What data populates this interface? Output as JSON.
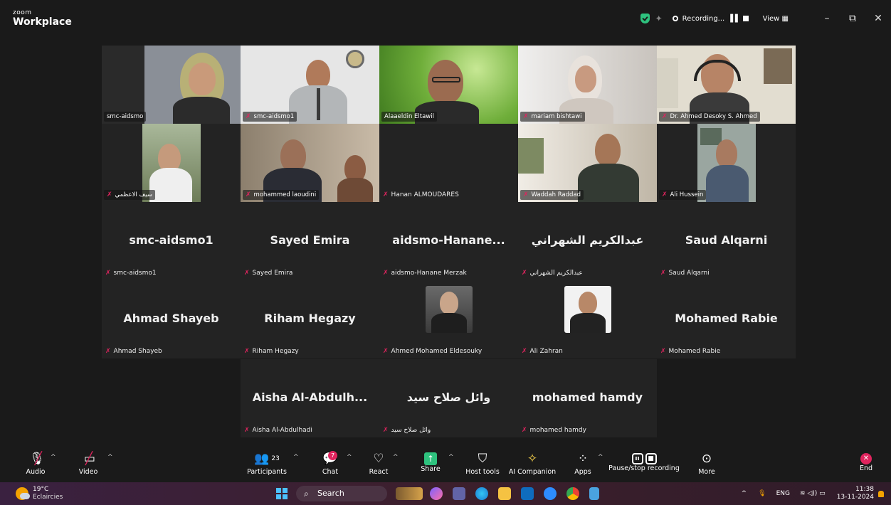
{
  "app": {
    "brand_top": "zoom",
    "brand_bottom": "Workplace"
  },
  "titlebar": {
    "recording_label": "Recording...",
    "view_label": "View",
    "view_icon": "grid-icon",
    "minimize": "–",
    "restore": "⧉",
    "close": "✕"
  },
  "video_tiles": [
    {
      "name": "smc-aidsmo",
      "muted": false,
      "bg": "#8a8f97",
      "shirt": "#2b2b2b",
      "skin": "#c99a7a",
      "hijab": "#b8b076"
    },
    {
      "name": "smc-aidsmo1",
      "muted": true,
      "bg": "#e6e6e6",
      "shirt": "#b3b6b8",
      "skin": "#b07a5a",
      "hijab": ""
    },
    {
      "name": "Alaaeldin Eltawil",
      "muted": false,
      "bg": "#6fae3a",
      "shirt": "#2a2a2a",
      "skin": "#9b6b50",
      "hijab": ""
    },
    {
      "name": "mariam bishtawi",
      "muted": true,
      "bg": "#d8d6d4",
      "shirt": "#cfc7bf",
      "skin": "#c89a80",
      "hijab": "#e8e2dc"
    },
    {
      "name": "Dr. Ahmed Desoky S. Ahmed",
      "muted": true,
      "bg": "#e2ddd0",
      "shirt": "#3a3a3a",
      "skin": "#b78466",
      "hijab": ""
    },
    {
      "name": "سيف الاعظمي",
      "muted": true,
      "bg": "#7b8a67",
      "shirt": "#efefef",
      "skin": "#c59a7c",
      "hijab": ""
    },
    {
      "name": "mohammed laoudini",
      "muted": true,
      "bg": "#a89a87",
      "shirt": "#2a2c34",
      "skin": "#9b7058",
      "hijab": "#8b5c43"
    },
    {
      "name": "Hanan ALMOUDARES",
      "muted": true,
      "bg": "#232323",
      "shirt": "",
      "skin": "",
      "hijab": ""
    },
    {
      "name": "Waddah Raddad",
      "muted": true,
      "bg": "#d9d2c4",
      "shirt": "#333a33",
      "skin": "#a57657",
      "hijab": ""
    },
    {
      "name": "Ali Hussein",
      "muted": true,
      "bg": "#9aa6a0",
      "shirt": "#4a5a70",
      "skin": "#a87a60",
      "hijab": ""
    }
  ],
  "name_tiles": [
    {
      "display": "smc-aidsmo1",
      "label": "smc-aidsmo1"
    },
    {
      "display": "Sayed Emira",
      "label": "Sayed Emira"
    },
    {
      "display": "aidsmo-Hanane...",
      "label": "aidsmo-Hanane Merzak"
    },
    {
      "display": "عبدالكريم الشهراني",
      "label": "عبدالكريم الشهراني"
    },
    {
      "display": "Saud Alqarni",
      "label": "Saud Alqarni"
    },
    {
      "display": "Ahmad Shayeb",
      "label": "Ahmad Shayeb"
    },
    {
      "display": "Riham Hegazy",
      "label": "Riham Hegazy"
    },
    {
      "display": "",
      "label": "Ahmed Mohamed Eldesouky"
    },
    {
      "display": "",
      "label": "Ali Zahran"
    },
    {
      "display": "Mohamed Rabie",
      "label": "Mohamed Rabie"
    },
    {
      "display": "Aisha  Al-Abdulh...",
      "label": "Aisha Al-Abdulhadi"
    },
    {
      "display": "وائل صلاح سيد",
      "label": "وائل صلاح سيد"
    },
    {
      "display": "mohamed hamdy",
      "label": "mohamed hamdy"
    }
  ],
  "toolbar": {
    "audio": "Audio",
    "video": "Video",
    "participants": "Participants",
    "participants_count": "23",
    "chat": "Chat",
    "chat_badge": "7",
    "react": "React",
    "share": "Share",
    "host_tools": "Host tools",
    "ai_companion": "AI Companion",
    "apps": "Apps",
    "pause_recording": "Pause/stop recording",
    "more": "More",
    "end": "End"
  },
  "taskbar": {
    "temperature": "19°C",
    "weather": "Eclaircies",
    "search_placeholder": "Search",
    "language": "ENG",
    "time": "11:38",
    "date": "13-11-2024"
  },
  "colors": {
    "accent_green": "#2ec27e",
    "mute_red": "#e0245e",
    "tile_bg": "#232323"
  }
}
